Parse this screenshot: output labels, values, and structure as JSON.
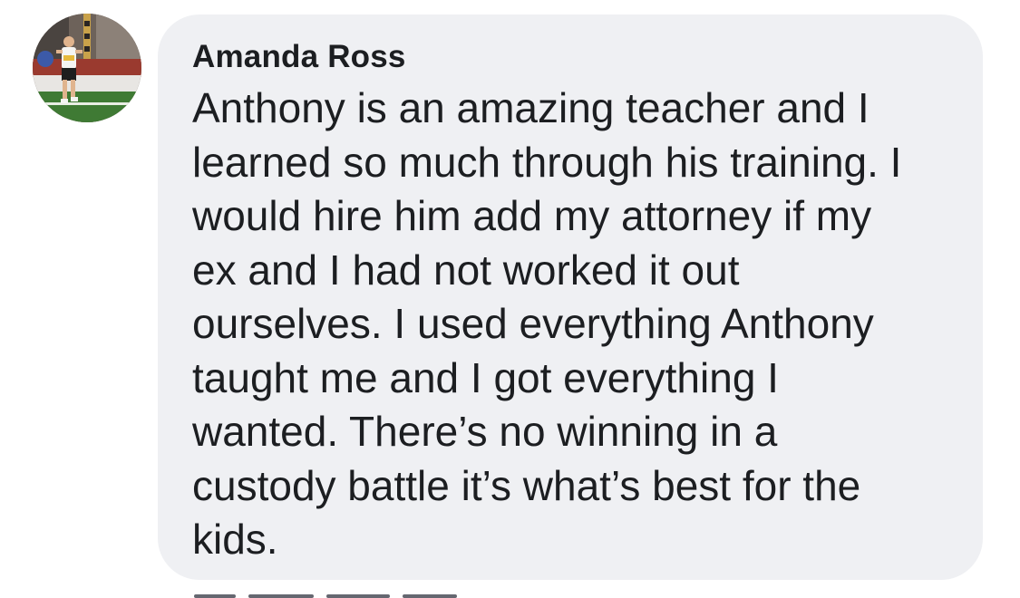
{
  "comment": {
    "author": "Amanda Ross",
    "text": "Anthony is an amazing teacher and I\nlearned so much through his training. I\nwould hire him add my attorney if my\nex and I had not worked it out\nourselves. I used everything Anthony\ntaught me and I got everything I\nwanted. There’s no winning in a\ncustody battle it’s what’s best for the\nkids.",
    "avatar": "profile-photo"
  },
  "colors": {
    "bubble_background": "#eff0f3",
    "text": "#1c1e21",
    "page_background": "#ffffff"
  }
}
